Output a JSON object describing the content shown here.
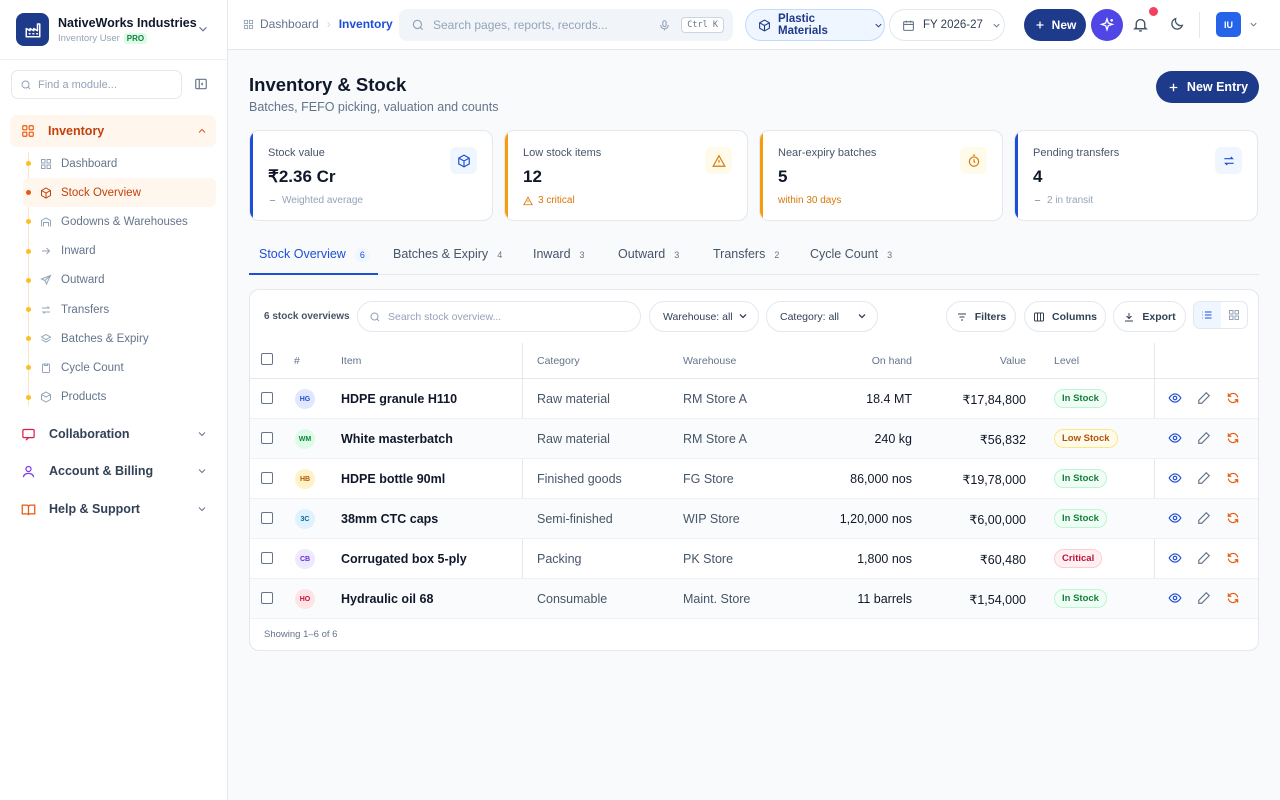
{
  "brand": {
    "name": "NativeWorks Industries",
    "role": "Inventory User",
    "plan": "PRO"
  },
  "sidebar": {
    "search_placeholder": "Find a module...",
    "inventory_group": {
      "label": "Inventory",
      "items": [
        {
          "label": "Dashboard",
          "icon": "grid-icon"
        },
        {
          "label": "Stock Overview",
          "icon": "box-icon"
        },
        {
          "label": "Godowns & Warehouses",
          "icon": "warehouse-icon"
        },
        {
          "label": "Inward",
          "icon": "arrow-right-icon"
        },
        {
          "label": "Outward",
          "icon": "send-icon"
        },
        {
          "label": "Transfers",
          "icon": "transfer-icon"
        },
        {
          "label": "Batches & Expiry",
          "icon": "layers-icon"
        },
        {
          "label": "Cycle Count",
          "icon": "clipboard-icon"
        },
        {
          "label": "Products",
          "icon": "product-icon"
        }
      ]
    },
    "groups": [
      {
        "label": "Collaboration",
        "icon": "chat-icon",
        "color": "#e11d48"
      },
      {
        "label": "Account & Billing",
        "icon": "user-icon",
        "color": "#7c3aed"
      },
      {
        "label": "Help & Support",
        "icon": "book-icon",
        "color": "#ea580c"
      }
    ]
  },
  "topbar": {
    "breadcrumb": [
      "Dashboard",
      "Inventory"
    ],
    "search_placeholder": "Search pages, reports, records...",
    "shortcut": "Ctrl K",
    "material": "Plastic Materials",
    "fiscal_year": "FY 2026-27",
    "new_label": "New",
    "avatar": "IU"
  },
  "page": {
    "title": "Inventory & Stock",
    "subtitle": "Batches, FEFO picking, valuation and counts",
    "new_entry_label": "New Entry"
  },
  "cards": [
    {
      "label": "Stock value",
      "value": "₹2.36 Cr",
      "note": "Weighted average",
      "accent": "#1d4ed8",
      "icon": "cube-icon"
    },
    {
      "label": "Low stock items",
      "value": "12",
      "note": "3 critical",
      "accent": "#f59e0b",
      "icon": "warning-icon"
    },
    {
      "label": "Near-expiry batches",
      "value": "5",
      "note": "within 30 days",
      "accent": "#f59e0b",
      "icon": "timer-icon"
    },
    {
      "label": "Pending transfers",
      "value": "4",
      "note": "2 in transit",
      "accent": "#1d4ed8",
      "icon": "transfer-icon"
    }
  ],
  "tabs": [
    {
      "label": "Stock Overview",
      "count": "6"
    },
    {
      "label": "Batches & Expiry",
      "count": "4"
    },
    {
      "label": "Inward",
      "count": "3"
    },
    {
      "label": "Outward",
      "count": "3"
    },
    {
      "label": "Transfers",
      "count": "2"
    },
    {
      "label": "Cycle Count",
      "count": "3"
    }
  ],
  "table": {
    "count_label": "6 stock overviews",
    "search_placeholder": "Search stock overview...",
    "warehouse_filter": "Warehouse: all",
    "category_filter": "Category: all",
    "filters_label": "Filters",
    "columns_label": "Columns",
    "export_label": "Export",
    "headers": {
      "num": "#",
      "item": "Item",
      "category": "Category",
      "warehouse": "Warehouse",
      "on_hand": "On hand",
      "value": "Value",
      "level": "Level"
    },
    "rows": [
      {
        "initials": "HG",
        "item": "HDPE granule H110",
        "category": "Raw material",
        "warehouse": "RM Store A",
        "on_hand": "18.4 MT",
        "value": "₹17,84,800",
        "level": "In Stock"
      },
      {
        "initials": "WM",
        "item": "White masterbatch",
        "category": "Raw material",
        "warehouse": "RM Store A",
        "on_hand": "240 kg",
        "value": "₹56,832",
        "level": "Low Stock"
      },
      {
        "initials": "HB",
        "item": "HDPE bottle 90ml",
        "category": "Finished goods",
        "warehouse": "FG Store",
        "on_hand": "86,000 nos",
        "value": "₹19,78,000",
        "level": "In Stock"
      },
      {
        "initials": "3C",
        "item": "38mm CTC caps",
        "category": "Semi-finished",
        "warehouse": "WIP Store",
        "on_hand": "1,20,000 nos",
        "value": "₹6,00,000",
        "level": "In Stock"
      },
      {
        "initials": "CB",
        "item": "Corrugated box 5-ply",
        "category": "Packing",
        "warehouse": "PK Store",
        "on_hand": "1,800 nos",
        "value": "₹60,480",
        "level": "Critical"
      },
      {
        "initials": "HO",
        "item": "Hydraulic oil 68",
        "category": "Consumable",
        "warehouse": "Maint. Store",
        "on_hand": "11 barrels",
        "value": "₹1,54,000",
        "level": "In Stock"
      }
    ],
    "footer": "Showing 1–6 of 6"
  }
}
